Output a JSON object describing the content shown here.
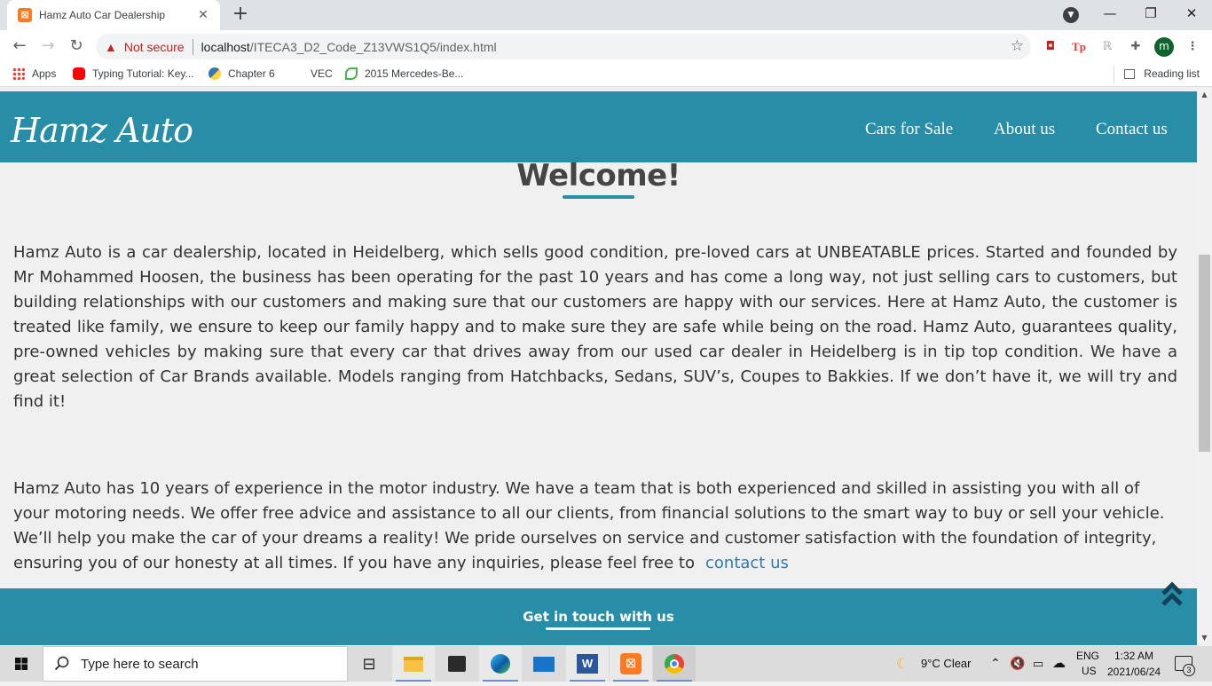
{
  "browser": {
    "tab_title": "Hamz Auto Car Dealership",
    "close_symbol": "✕",
    "new_tab_symbol": "+",
    "not_secure": "Not secure",
    "url_host": "localhost",
    "url_path": "/ITECA3_D2_Code_Z13VWS1Q5/index.html",
    "profile_initial": "m",
    "bookmarks": [
      {
        "label": "Apps",
        "icon": "apps-grid-icon"
      },
      {
        "label": "Typing Tutorial: Key...",
        "icon": "youtube-icon"
      },
      {
        "label": "Chapter 6",
        "icon": "python-icon"
      },
      {
        "label": "VEC",
        "icon": "blank-icon"
      },
      {
        "label": "2015 Mercedes-Be...",
        "icon": "leaf-icon"
      }
    ],
    "reading_list": "Reading list"
  },
  "site": {
    "logo": "Hamz Auto",
    "nav": [
      "Cars for Sale",
      "About us",
      "Contact us"
    ],
    "welcome": "Welcome!",
    "paragraph1": "Hamz Auto is a car dealership, located in Heidelberg, which sells good condition, pre-loved cars at UNBEATABLE prices. Started and founded by Mr Mohammed Hoosen, the business has been operating for the past 10 years and has come a long way, not just selling cars to customers, but building relationships with our customers and making sure that our customers are happy with our services. Here at Hamz Auto, the customer is treated like family, we ensure to keep our family happy and to make sure they are safe while being on the road. Hamz Auto, guarantees quality, pre-owned vehicles by making sure that every car that drives away from our used car dealer in Heidelberg is in tip top condition. We have a great selection of Car Brands available. Models ranging from Hatchbacks, Sedans, SUV’s, Coupes to Bakkies. If we don’t have it, we will try and find it!",
    "paragraph2": "Hamz Auto has 10 years of experience in the motor industry. We have a team that is both experienced and skilled in assisting you with all of your motoring needs. We offer free advice and assistance to all our clients, from financial solutions to the smart way to buy or sell your vehicle. We’ll help you make the car of your dreams a reality! We pride ourselves on service and customer satisfaction with the foundation of integrity, ensuring you of our honesty at all times. If you have any inquiries, please feel free to",
    "paragraph2_link": "contact us",
    "footer_title": "Get in touch with us"
  },
  "taskbar": {
    "search_placeholder": "Type here to search",
    "weather": "9°C  Clear",
    "lang_top": "ENG",
    "lang_bottom": "US",
    "time": "1:32 AM",
    "date": "2021/06/24",
    "notifications": "3"
  },
  "colors": {
    "brand": "#288da6",
    "link": "#2f7bb5",
    "not_secure": "#c5221f"
  }
}
